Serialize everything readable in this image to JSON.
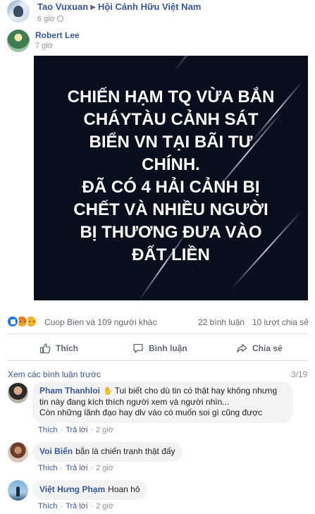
{
  "post": {
    "author": "Tao Vuxuan",
    "group": "Hội Cánh Hữu Việt Nam",
    "time": "6 giờ"
  },
  "shared": {
    "author": "Robert Lee",
    "time": "7 giờ"
  },
  "image_text": [
    "CHIẾN HẠM TQ VỪA BẮN",
    "CHÁYTÀU CẢNH SÁT",
    "BIỂN VN TẠI BÃI TƯ",
    "CHÍNH.",
    "ĐÃ CÓ 4 HẢI CẢNH BỊ",
    "CHẾT VÀ NHIỀU NGƯỜI",
    "BỊ THƯƠNG ĐƯA VÀO",
    "ĐẤT LIỀN"
  ],
  "stats": {
    "reactions": "Cuop Bien và 109 người khác",
    "comments": "22 bình luận",
    "shares": "10 lượt chia sẻ",
    "reaction_icons": [
      "like-icon",
      "angry-icon",
      "sad-icon"
    ]
  },
  "actions": {
    "like": "Thích",
    "comment": "Bình luận",
    "share": "Chia sẻ"
  },
  "comments_section": {
    "view_previous": "Xem các bình luận trước",
    "page_count": "3/19",
    "reply_label": "Trả lời",
    "like_label": "Thích",
    "comments": [
      {
        "name": "Pham Thanhloi",
        "text": "Tui biết cho dù tin có thật hay không nhưng tin này đang kích thích người xem và người nhìn...\nCòn những lãnh đạo hay dlv vào có muốn soi gì cũng được",
        "time": "2 giờ"
      },
      {
        "name": "Voi Biển",
        "text": "bắn là chiến tranh thật đấy",
        "time": "2 giờ"
      },
      {
        "name": "Việt Hưng Phạm",
        "text": "Hoan hô",
        "time": "2 giờ"
      }
    ]
  },
  "colors": {
    "link": "#385898",
    "meta": "#90949c",
    "image_bg": "#0a0f1e",
    "bubble": "#f2f3f5",
    "like_blue": "#1877f2"
  }
}
